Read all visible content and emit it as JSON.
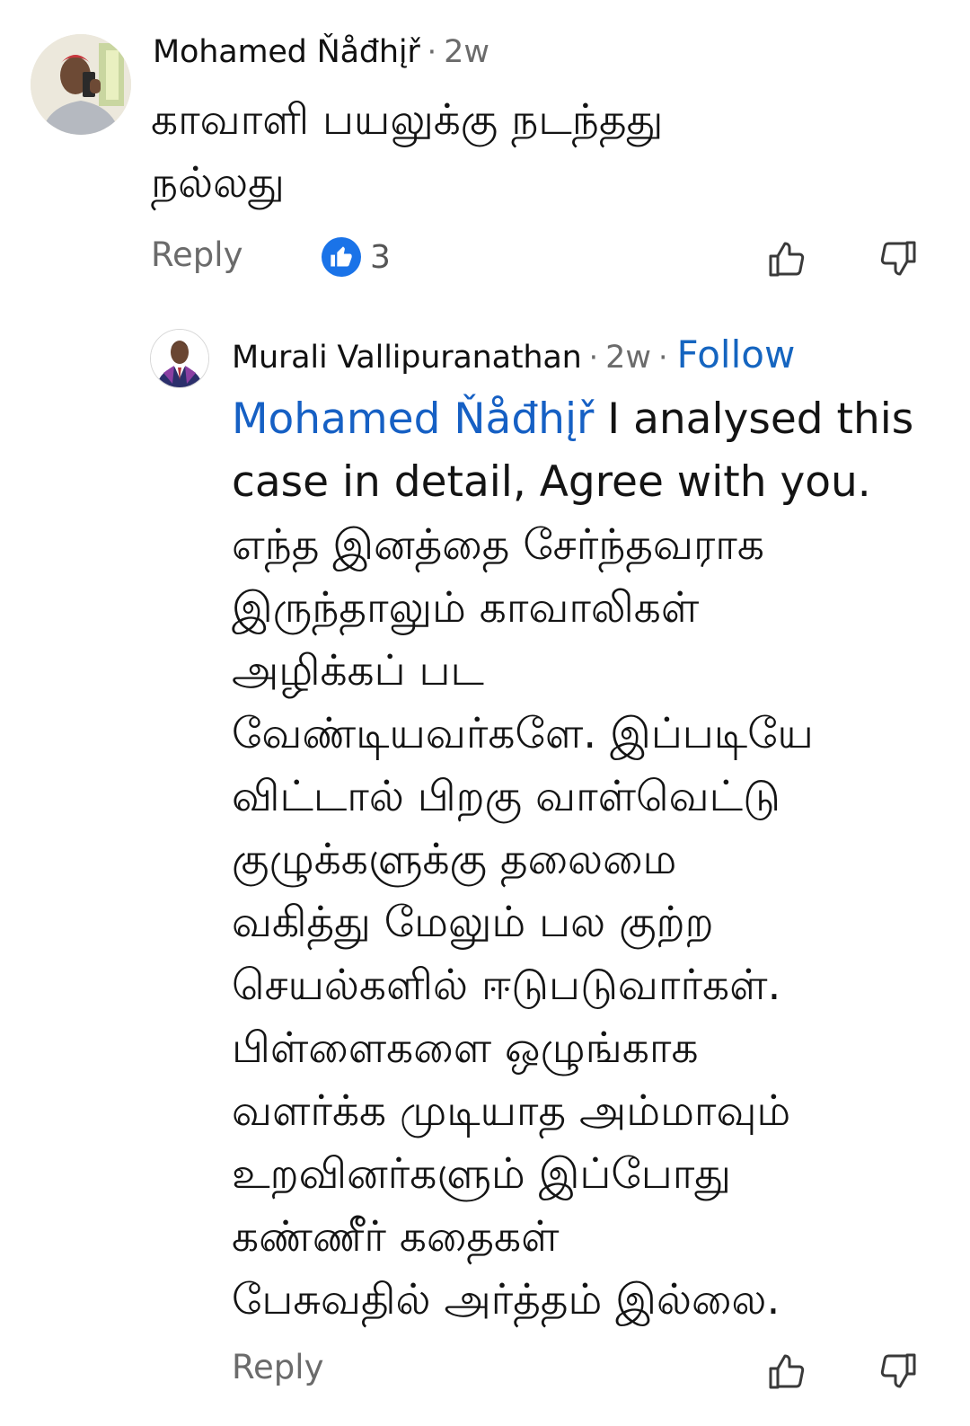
{
  "comments": [
    {
      "author": "Mohamed Ňåđhįř",
      "age": "2w",
      "text_lines": [
        "காவாளி பயலுக்கு நடந்தது",
        "நல்லது"
      ],
      "reply_label": "Reply",
      "like_count": "3"
    }
  ],
  "reply": {
    "author": "Murali Vallipuranathan",
    "age": "2w",
    "follow_label": "Follow",
    "mention": "Mohamed Ňåđhįř",
    "first_line_rest": " I analysed this",
    "text_lines": [
      "case in detail, Agree with you.",
      "எந்த இனத்தை சேர்ந்தவராக",
      "இருந்தாலும் காவாலிகள்",
      "அழிக்கப் பட",
      "வேண்டியவர்களே. இப்படியே",
      "விட்டால் பிறகு வாள்வெட்டு",
      "குழுக்களுக்கு தலைமை",
      "வகித்து மேலும் பல குற்ற",
      "செயல்களில் ஈடுபடுவார்கள்.",
      "பிள்ளைகளை ஒழுங்காக",
      "வளர்க்க முடியாத அம்மாவும்",
      "உறவினர்களும் இப்போது",
      "கண்ணீர் கதைகள்",
      "பேசுவதில் அர்த்தம் இல்லை."
    ],
    "reply_label": "Reply"
  },
  "icons": {
    "like": "thumbs-up-icon",
    "dislike": "thumbs-down-icon",
    "reaction": "like-reaction-icon"
  },
  "colors": {
    "accent": "#1565c0",
    "mention": "#1660c4",
    "reaction_badge": "#1a73e8",
    "muted_text": "#6b6b6b"
  }
}
